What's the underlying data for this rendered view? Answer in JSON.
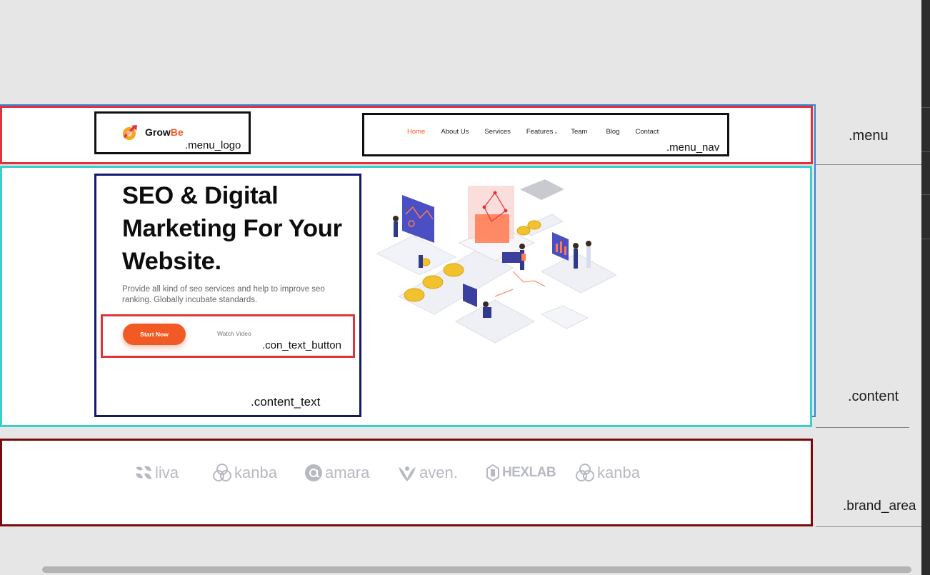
{
  "menu": {
    "logo": {
      "part1": "Grow",
      "part2": "Be"
    },
    "nav": [
      "Home",
      "About Us",
      "Services",
      "Features",
      "Team",
      "Blog",
      "Contact"
    ],
    "active_index": 0
  },
  "hero": {
    "title": "SEO & Digital Marketing For Your Website.",
    "description": "Provide all kind of seo services and help to improve seo ranking. Globally incubate standards.",
    "primary_button": "Start Now",
    "secondary_button": "Watch Video"
  },
  "brands": [
    {
      "name": "liva",
      "icon": "liva-leaf-icon"
    },
    {
      "name": "kanba",
      "icon": "kanba-knot-icon"
    },
    {
      "name": "amara",
      "icon": "amara-at-icon"
    },
    {
      "name": "aven.",
      "icon": "aven-v-icon"
    },
    {
      "name": "HEXLAB",
      "icon": "hexlab-flask-icon"
    },
    {
      "name": "kanba",
      "icon": "kanba-knot-icon"
    }
  ],
  "class_labels": {
    "menu_logo": ".menu_logo",
    "menu_nav": ".menu_nav",
    "con_text_button": ".con_text_button",
    "content_text": ".content_text",
    "menu": ".menu",
    "content": ".content",
    "brand_area": ".brand_area"
  },
  "colors": {
    "accent": "#f15a24",
    "menu_border": "#e2333a",
    "content_border": "#37cfd0",
    "content_text_border": "#131a6b",
    "brand_border": "#7d0a0a",
    "outer_frame": "#2f86d6"
  }
}
